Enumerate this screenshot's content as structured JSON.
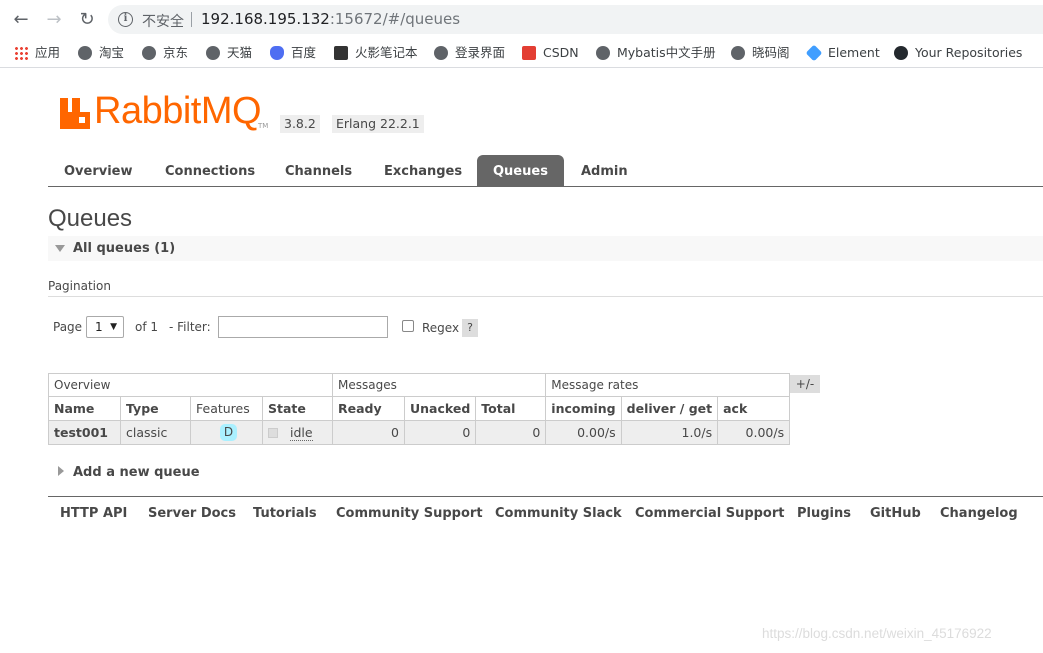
{
  "browser": {
    "back_icon": "arrow-left-icon",
    "forward_icon": "arrow-right-icon",
    "reload_icon": "reload-icon",
    "security_text": "不安全",
    "url_host": "192.168.195.132",
    "url_rest": ":15672/#/queues"
  },
  "bookmarks": [
    {
      "label": "应用",
      "icon": "apps-grid-icon"
    },
    {
      "label": "淘宝",
      "icon": "globe-icon"
    },
    {
      "label": "京东",
      "icon": "globe-icon"
    },
    {
      "label": "天猫",
      "icon": "globe-icon"
    },
    {
      "label": "百度",
      "icon": "baidu-paw-icon"
    },
    {
      "label": "火影笔记本",
      "icon": "site-icon"
    },
    {
      "label": "登录界面",
      "icon": "globe-icon"
    },
    {
      "label": "CSDN",
      "icon": "csdn-icon"
    },
    {
      "label": "Mybatis中文手册",
      "icon": "globe-icon"
    },
    {
      "label": "晓码阁",
      "icon": "globe-icon"
    },
    {
      "label": "Element",
      "icon": "element-icon"
    },
    {
      "label": "Your Repositories",
      "icon": "github-icon"
    }
  ],
  "app": {
    "logo_text": "RabbitMQ",
    "logo_tm": "TM",
    "version": "3.8.2",
    "erlang": "Erlang 22.2.1",
    "brand_color": "#ff6600"
  },
  "tabs": [
    {
      "label": "Overview",
      "active": false
    },
    {
      "label": "Connections",
      "active": false
    },
    {
      "label": "Channels",
      "active": false
    },
    {
      "label": "Exchanges",
      "active": false
    },
    {
      "label": "Queues",
      "active": true
    },
    {
      "label": "Admin",
      "active": false
    }
  ],
  "page": {
    "title": "Queues",
    "section_title": "All queues (1)",
    "pagination_label": "Pagination",
    "page_label": "Page",
    "page_value": "1",
    "of_label": "of 1",
    "filter_label": "- Filter:",
    "filter_value": "",
    "regex_label": "Regex",
    "help_label": "?",
    "columns_toggle": "+/-",
    "add_queue": "Add a new queue"
  },
  "table": {
    "groups": [
      "Overview",
      "Messages",
      "Message rates"
    ],
    "columns": [
      "Name",
      "Type",
      "Features",
      "State",
      "Ready",
      "Unacked",
      "Total",
      "incoming",
      "deliver / get",
      "ack"
    ],
    "rows": [
      {
        "name": "test001",
        "type": "classic",
        "features": "D",
        "state": "idle",
        "ready": "0",
        "unacked": "0",
        "total": "0",
        "incoming": "0.00/s",
        "deliver_get": "1.0/s",
        "ack": "0.00/s"
      }
    ]
  },
  "footer": [
    "HTTP API",
    "Server Docs",
    "Tutorials",
    "Community Support",
    "Community Slack",
    "Commercial Support",
    "Plugins",
    "GitHub",
    "Changelog"
  ],
  "watermark": "https://blog.csdn.net/weixin_45176922"
}
